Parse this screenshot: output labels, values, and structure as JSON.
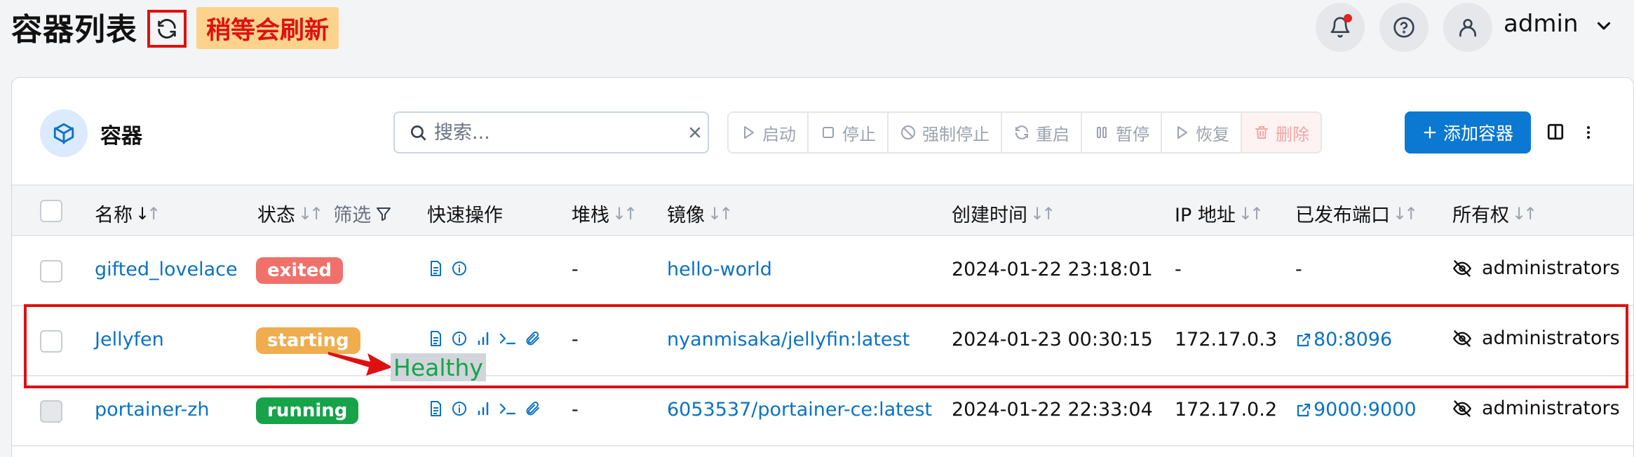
{
  "header": {
    "title": "容器列表",
    "refresh_note": "稍等会刷新",
    "user": "admin"
  },
  "card": {
    "title": "容器",
    "search_placeholder": "搜索...",
    "actions": [
      {
        "label": "启动",
        "icon": "play-icon"
      },
      {
        "label": "停止",
        "icon": "stop-icon"
      },
      {
        "label": "强制停止",
        "icon": "ban-icon"
      },
      {
        "label": "重启",
        "icon": "restart-icon"
      },
      {
        "label": "暂停",
        "icon": "pause-icon"
      },
      {
        "label": "恢复",
        "icon": "resume-icon"
      },
      {
        "label": "删除",
        "icon": "trash-icon"
      }
    ],
    "add_label": "添加容器"
  },
  "table": {
    "columns": {
      "name": "名称",
      "state": "状态",
      "filter": "筛选",
      "quick": "快速操作",
      "stack": "堆栈",
      "image": "镜像",
      "created": "创建时间",
      "ip": "IP 地址",
      "ports": "已发布端口",
      "ownership": "所有权"
    },
    "rows": [
      {
        "name": "gifted_lovelace",
        "state": "exited",
        "stack": "-",
        "image": "hello-world",
        "created": "2024-01-22 23:18:01",
        "ip": "-",
        "ports": "-",
        "ownership": "administrators"
      },
      {
        "name": "Jellyfen",
        "state": "starting",
        "stack": "-",
        "image": "nyanmisaka/jellyfin:latest",
        "created": "2024-01-23 00:30:15",
        "ip": "172.17.0.3",
        "ports": "80:8096",
        "ownership": "administrators"
      },
      {
        "name": "portainer-zh",
        "state": "running",
        "stack": "-",
        "image": "6053537/portainer-ce:latest",
        "created": "2024-01-22 22:33:04",
        "ip": "172.17.0.2",
        "ports": "9000:9000",
        "ownership": "administrators"
      }
    ]
  },
  "annotation": {
    "healthy": "Healthy"
  },
  "colors": {
    "exited": "#f2706a",
    "starting": "#f0ad4e",
    "running": "#16a34a",
    "primary": "#0b78d1",
    "highlight": "#e01010"
  }
}
